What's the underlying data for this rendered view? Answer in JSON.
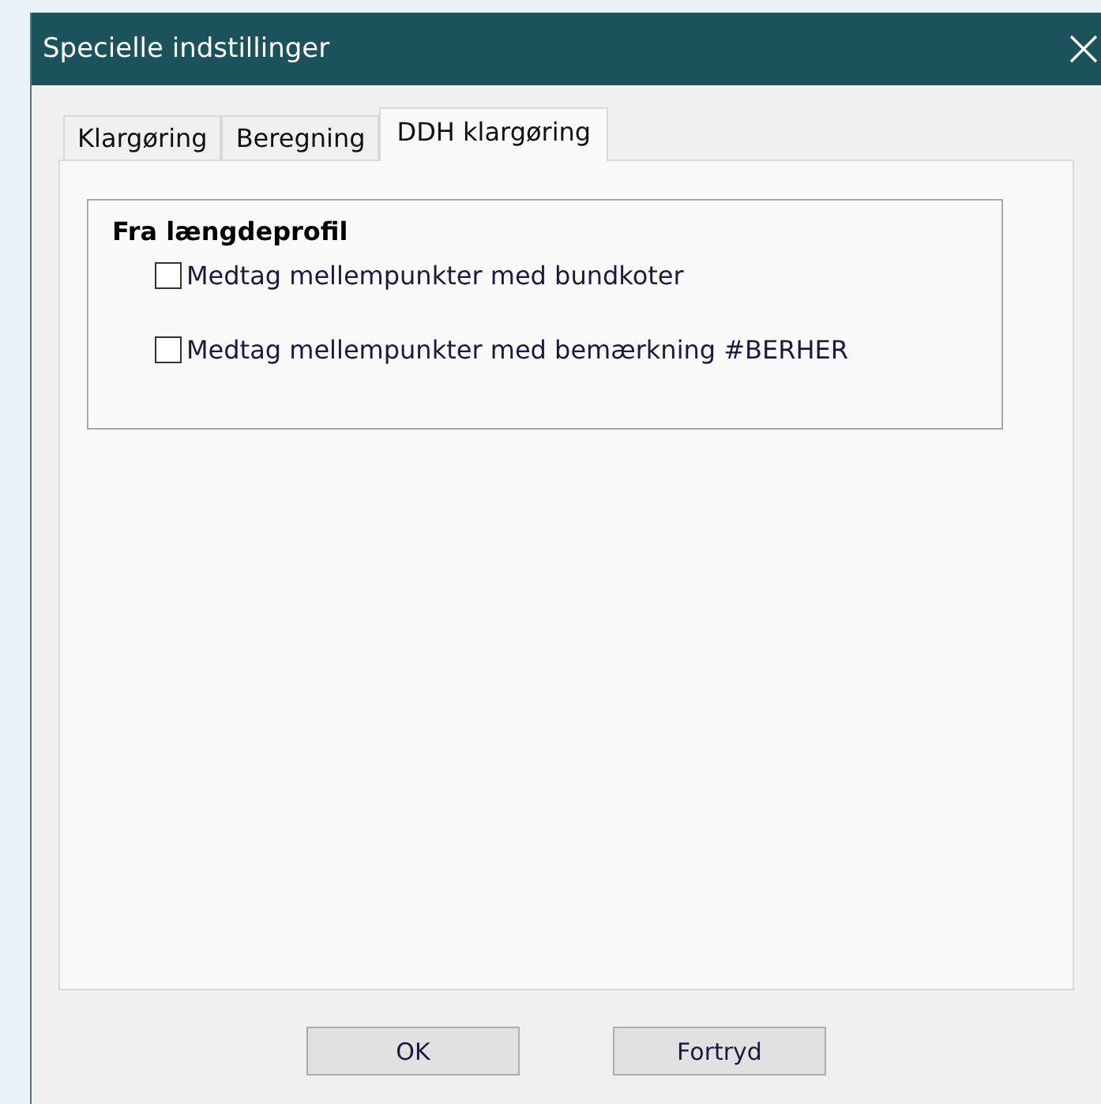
{
  "window": {
    "title": "Specielle indstillinger"
  },
  "tabs": [
    {
      "label": "Klargøring",
      "selected": false
    },
    {
      "label": "Beregning",
      "selected": false
    },
    {
      "label": "DDH klargøring",
      "selected": true
    }
  ],
  "group": {
    "title": "Fra længdeprofil",
    "options": [
      {
        "label": "Medtag mellempunkter med bundkoter",
        "checked": false
      },
      {
        "label": "Medtag mellempunkter med bemærkning #BERHER",
        "checked": false
      }
    ]
  },
  "buttons": [
    "OK",
    "Fortryd"
  ]
}
